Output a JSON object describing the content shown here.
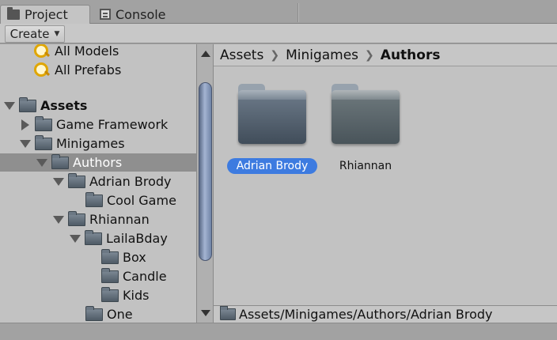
{
  "tabs": {
    "project_label": "Project",
    "console_label": "Console",
    "project_icon": "folder-icon",
    "console_icon": "console-icon"
  },
  "toolbar": {
    "create_label": "Create"
  },
  "tree": {
    "all_models": "All Models",
    "all_prefabs": "All Prefabs",
    "assets": "Assets",
    "game_framework": "Game Framework",
    "minigames": "Minigames",
    "authors": "Authors",
    "adrian_brody": "Adrian Brody",
    "cool_game": "Cool Game",
    "rhiannan": "Rhiannan",
    "lailabday": "LailaBday",
    "box": "Box",
    "candle": "Candle",
    "kids": "Kids",
    "one": "One"
  },
  "breadcrumb": {
    "items": [
      "Assets",
      "Minigames",
      "Authors"
    ]
  },
  "grid": {
    "items": [
      {
        "label": "Adrian Brody",
        "selected": true
      },
      {
        "label": "Rhiannan",
        "selected": false
      }
    ]
  },
  "pathbar": {
    "path": "Assets/Minigames/Authors/Adrian Brody"
  },
  "colors": {
    "selection_blue": "#3d7be0",
    "tree_selection": "#8f8f8f",
    "panel_bg": "#c2c2c2"
  }
}
